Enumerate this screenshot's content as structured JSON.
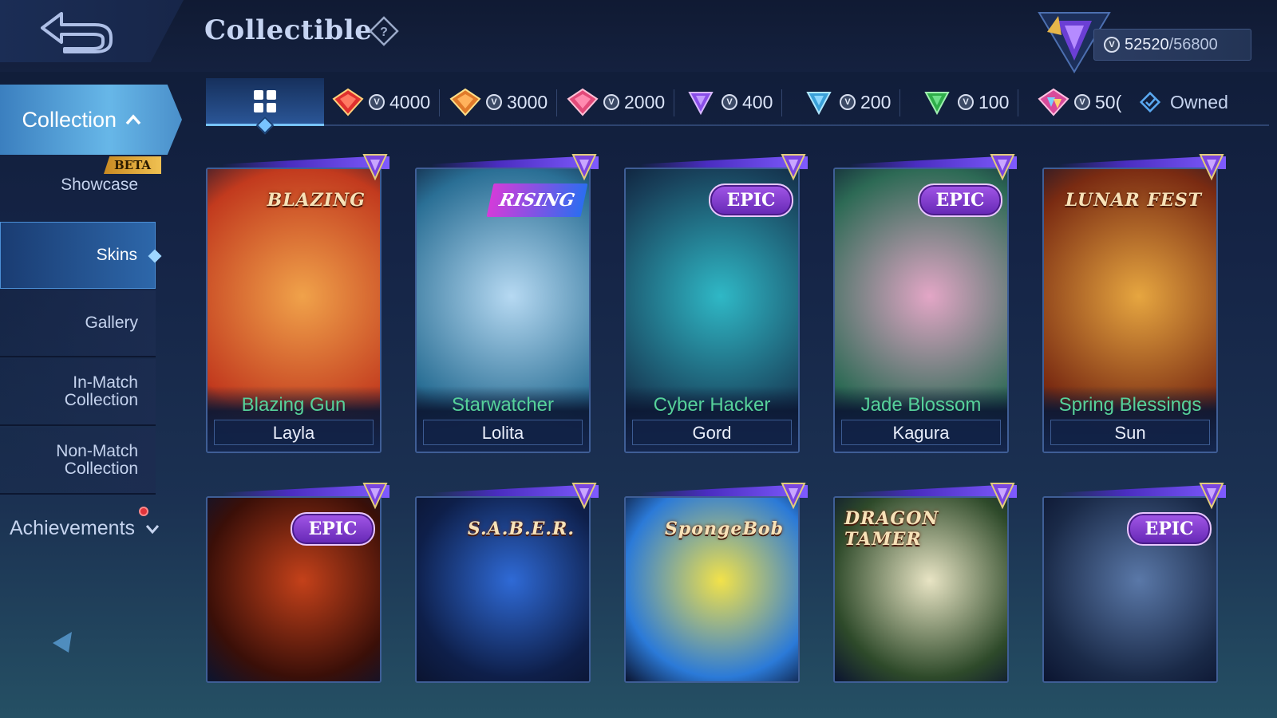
{
  "header": {
    "title": "Collectible",
    "points": {
      "current": "52520",
      "max": "/56800"
    }
  },
  "sidebar": {
    "collection": {
      "label": "Collection",
      "beta": "BETA"
    },
    "items": [
      {
        "label": "Showcase"
      },
      {
        "label": "Skins"
      },
      {
        "label": "Gallery"
      },
      {
        "label": "In-Match Collection"
      },
      {
        "label": "Non-Match Collection"
      }
    ],
    "achievements": "Achievements"
  },
  "tiers": [
    {
      "value": "4000",
      "gem_color": "#e0302e"
    },
    {
      "value": "3000",
      "gem_color": "#e07a2a"
    },
    {
      "value": "2000",
      "gem_color": "#e24a7a"
    },
    {
      "value": "400",
      "gem_color": "#8a4ee8"
    },
    {
      "value": "200",
      "gem_color": "#3aa0d8"
    },
    {
      "value": "100",
      "gem_color": "#2fae4a"
    },
    {
      "value": "50(",
      "gem_color": "#d84a9a"
    }
  ],
  "owned_label": "Owned",
  "cards_row1": [
    {
      "skin": "Blazing Gun",
      "hero": "Layla",
      "badge": "BLAZING",
      "art_color_a": "#c23a1e",
      "art_color_b": "#f0a24a"
    },
    {
      "skin": "Starwatcher",
      "hero": "Lolita",
      "badge": "RISING",
      "art_color_a": "#2a6f95",
      "art_color_b": "#b6d9f2"
    },
    {
      "skin": "Cyber Hacker",
      "hero": "Gord",
      "badge": "EPIC",
      "art_color_a": "#18405a",
      "art_color_b": "#2fb8c6"
    },
    {
      "skin": "Jade Blossom",
      "hero": "Kagura",
      "badge": "EPIC",
      "art_color_a": "#2d6a55",
      "art_color_b": "#e3a6c6"
    },
    {
      "skin": "Spring Blessings",
      "hero": "Sun",
      "badge": "LUNAR FEST",
      "art_color_a": "#7a2b12",
      "art_color_b": "#e6a640"
    }
  ],
  "cards_row2": [
    {
      "badge": "EPIC",
      "art_color_a": "#3a0f08",
      "art_color_b": "#c4411a"
    },
    {
      "badge": "S.A.B.E.R.",
      "art_color_a": "#0e1f4a",
      "art_color_b": "#2f6ad6"
    },
    {
      "badge": "SpongeBob",
      "art_color_a": "#2b7ad8",
      "art_color_b": "#f2e24a"
    },
    {
      "badge": "DRAGON TAMER",
      "art_color_a": "#2e4a2a",
      "art_color_b": "#e8e4c4"
    },
    {
      "badge": "EPIC",
      "art_color_a": "#1a2a48",
      "art_color_b": "#5a78a8"
    }
  ]
}
